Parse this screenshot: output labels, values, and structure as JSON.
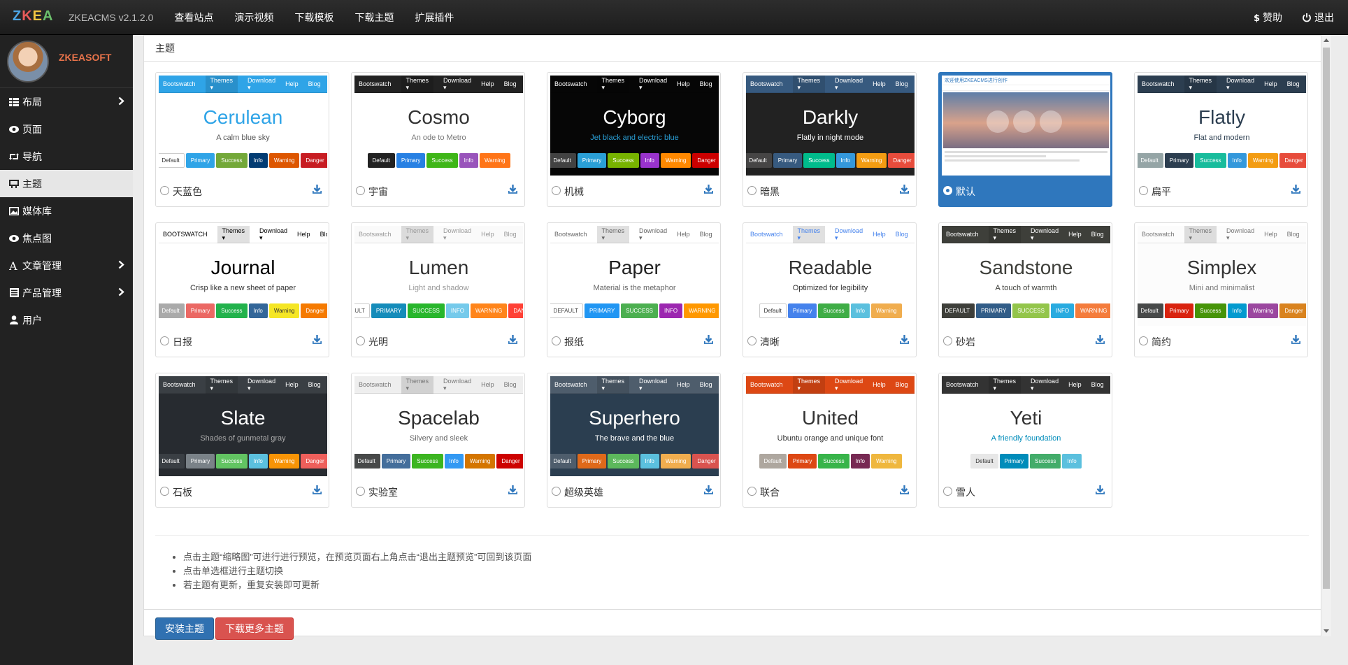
{
  "app": {
    "logo_letters": [
      "Z",
      "K",
      "E",
      "A"
    ],
    "logo_colors": [
      "#4da7e8",
      "#e85b5b",
      "#f4c542",
      "#6cc06c"
    ],
    "version": "ZKEACMS v2.1.2.0"
  },
  "topnav": [
    {
      "label": "查看站点"
    },
    {
      "label": "演示视频"
    },
    {
      "label": "下载模板"
    },
    {
      "label": "下载主题"
    },
    {
      "label": "扩展插件"
    }
  ],
  "topright": {
    "donate": "赞助",
    "logout": "退出"
  },
  "profile": {
    "name": "ZKEASOFT"
  },
  "sidebar": [
    {
      "label": "布局",
      "icon": "layout-icon",
      "has_sub": true,
      "active": false
    },
    {
      "label": "页面",
      "icon": "eye-icon",
      "has_sub": false,
      "active": false
    },
    {
      "label": "导航",
      "icon": "retweet-icon",
      "has_sub": false,
      "active": false
    },
    {
      "label": "主题",
      "icon": "blackboard-icon",
      "has_sub": false,
      "active": true
    },
    {
      "label": "媒体库",
      "icon": "picture-icon",
      "has_sub": false,
      "active": false
    },
    {
      "label": "焦点图",
      "icon": "eye-icon",
      "has_sub": false,
      "active": false
    },
    {
      "label": "文章管理",
      "icon": "font-icon",
      "has_sub": true,
      "active": false
    },
    {
      "label": "产品管理",
      "icon": "list-alt-icon",
      "has_sub": true,
      "active": false
    },
    {
      "label": "用户",
      "icon": "user-icon",
      "has_sub": false,
      "active": false
    }
  ],
  "panel": {
    "title": "主题"
  },
  "themes": [
    {
      "id": "cerulean",
      "name": "天蓝色",
      "title": "Cerulean",
      "subtitle": "A calm blue sky",
      "nav_bg": "#2fa4e7",
      "nav_fg": "#ffffff",
      "body_bg": "#ffffff",
      "title_color": "#2fa4e7",
      "sub_color": "#555555",
      "brand": "Bootswatch",
      "selected": false,
      "buttons": [
        {
          "t": "Default",
          "bg": "#ffffff",
          "fg": "#333"
        },
        {
          "t": "Primary",
          "bg": "#2fa4e7",
          "fg": "#fff"
        },
        {
          "t": "Success",
          "bg": "#73a839",
          "fg": "#fff"
        },
        {
          "t": "Info",
          "bg": "#033c73",
          "fg": "#fff"
        },
        {
          "t": "Warning",
          "bg": "#dd5600",
          "fg": "#fff"
        },
        {
          "t": "Danger",
          "bg": "#c71c22",
          "fg": "#fff"
        }
      ]
    },
    {
      "id": "cosmo",
      "name": "宇宙",
      "title": "Cosmo",
      "subtitle": "An ode to Metro",
      "nav_bg": "#222222",
      "nav_fg": "#ffffff",
      "body_bg": "#ffffff",
      "title_color": "#333333",
      "sub_color": "#777777",
      "brand": "Bootswatch",
      "selected": false,
      "buttons": [
        {
          "t": "Default",
          "bg": "#222222",
          "fg": "#fff"
        },
        {
          "t": "Primary",
          "bg": "#2780e3",
          "fg": "#fff"
        },
        {
          "t": "Success",
          "bg": "#3fb618",
          "fg": "#fff"
        },
        {
          "t": "Info",
          "bg": "#9954bb",
          "fg": "#fff"
        },
        {
          "t": "Warning",
          "bg": "#ff7518",
          "fg": "#fff"
        }
      ]
    },
    {
      "id": "cyborg",
      "name": "机械",
      "title": "Cyborg",
      "subtitle": "Jet black and electric blue",
      "nav_bg": "#060606",
      "nav_fg": "#ffffff",
      "body_bg": "#060606",
      "title_color": "#ffffff",
      "sub_color": "#2a9fd6",
      "brand": "Bootswatch",
      "selected": false,
      "buttons": [
        {
          "t": "Default",
          "bg": "#424242",
          "fg": "#fff"
        },
        {
          "t": "Primary",
          "bg": "#2a9fd6",
          "fg": "#fff"
        },
        {
          "t": "Success",
          "bg": "#77b300",
          "fg": "#fff"
        },
        {
          "t": "Info",
          "bg": "#9933cc",
          "fg": "#fff"
        },
        {
          "t": "Warning",
          "bg": "#ff8800",
          "fg": "#fff"
        },
        {
          "t": "Danger",
          "bg": "#cc0000",
          "fg": "#fff"
        }
      ]
    },
    {
      "id": "darkly",
      "name": "暗黑",
      "title": "Darkly",
      "subtitle": "Flatly in night mode",
      "nav_bg": "#375a7f",
      "nav_fg": "#ffffff",
      "body_bg": "#222222",
      "title_color": "#ffffff",
      "sub_color": "#ffffff",
      "brand": "Bootswatch",
      "selected": false,
      "buttons": [
        {
          "t": "Default",
          "bg": "#464545",
          "fg": "#fff"
        },
        {
          "t": "Primary",
          "bg": "#375a7f",
          "fg": "#fff"
        },
        {
          "t": "Success",
          "bg": "#00bc8c",
          "fg": "#fff"
        },
        {
          "t": "Info",
          "bg": "#3498db",
          "fg": "#fff"
        },
        {
          "t": "Warning",
          "bg": "#f39c12",
          "fg": "#fff"
        },
        {
          "t": "Danger",
          "bg": "#e74c3c",
          "fg": "#fff"
        }
      ]
    },
    {
      "id": "default",
      "name": "默认",
      "title": "",
      "subtitle": "",
      "nav_bg": "#ffffff",
      "nav_fg": "#2f77bd",
      "body_bg": "#ffffff",
      "title_color": "#333",
      "sub_color": "#333",
      "brand": "欢迎使用ZKEACMS进行创作",
      "selected": true,
      "buttons": []
    },
    {
      "id": "flatly",
      "name": "扁平",
      "title": "Flatly",
      "subtitle": "Flat and modern",
      "nav_bg": "#2c3e50",
      "nav_fg": "#ffffff",
      "body_bg": "#ffffff",
      "title_color": "#2c3e50",
      "sub_color": "#2c3e50",
      "brand": "Bootswatch",
      "selected": false,
      "buttons": [
        {
          "t": "Default",
          "bg": "#95a5a6",
          "fg": "#fff"
        },
        {
          "t": "Primary",
          "bg": "#2c3e50",
          "fg": "#fff"
        },
        {
          "t": "Success",
          "bg": "#18bc9c",
          "fg": "#fff"
        },
        {
          "t": "Info",
          "bg": "#3498db",
          "fg": "#fff"
        },
        {
          "t": "Warning",
          "bg": "#f39c12",
          "fg": "#fff"
        },
        {
          "t": "Danger",
          "bg": "#e74c3c",
          "fg": "#fff"
        }
      ]
    },
    {
      "id": "journal",
      "name": "日报",
      "title": "Journal",
      "subtitle": "Crisp like a new sheet of paper",
      "nav_bg": "#ffffff",
      "nav_fg": "#000000",
      "body_bg": "#ffffff",
      "title_color": "#000000",
      "sub_color": "#333333",
      "brand": "BOOTSWATCH",
      "selected": false,
      "buttons": [
        {
          "t": "Default",
          "bg": "#aaaaaa",
          "fg": "#fff"
        },
        {
          "t": "Primary",
          "bg": "#eb6864",
          "fg": "#fff"
        },
        {
          "t": "Success",
          "bg": "#22b24c",
          "fg": "#fff"
        },
        {
          "t": "Info",
          "bg": "#336699",
          "fg": "#fff"
        },
        {
          "t": "Warning",
          "bg": "#f5e625",
          "fg": "#333"
        },
        {
          "t": "Danger",
          "bg": "#f57a00",
          "fg": "#fff"
        }
      ]
    },
    {
      "id": "lumen",
      "name": "光明",
      "title": "Lumen",
      "subtitle": "Light and shadow",
      "nav_bg": "#fafafa",
      "nav_fg": "#999999",
      "body_bg": "#ffffff",
      "title_color": "#333333",
      "sub_color": "#999999",
      "brand": "Bootswatch",
      "selected": false,
      "buttons": [
        {
          "t": "DEFAULT",
          "bg": "#ffffff",
          "fg": "#555"
        },
        {
          "t": "PRIMARY",
          "bg": "#158cba",
          "fg": "#fff"
        },
        {
          "t": "SUCCESS",
          "bg": "#28b62c",
          "fg": "#fff"
        },
        {
          "t": "INFO",
          "bg": "#75caeb",
          "fg": "#fff"
        },
        {
          "t": "WARNING",
          "bg": "#ff851b",
          "fg": "#fff"
        },
        {
          "t": "DANGER",
          "bg": "#ff4136",
          "fg": "#fff"
        }
      ]
    },
    {
      "id": "paper",
      "name": "报纸",
      "title": "Paper",
      "subtitle": "Material is the metaphor",
      "nav_bg": "#ffffff",
      "nav_fg": "#666666",
      "body_bg": "#ffffff",
      "title_color": "#212121",
      "sub_color": "#666666",
      "brand": "Bootswatch",
      "selected": false,
      "buttons": [
        {
          "t": "DEFAULT",
          "bg": "#ffffff",
          "fg": "#444"
        },
        {
          "t": "PRIMARY",
          "bg": "#2196f3",
          "fg": "#fff"
        },
        {
          "t": "SUCCESS",
          "bg": "#4caf50",
          "fg": "#fff"
        },
        {
          "t": "INFO",
          "bg": "#9c27b0",
          "fg": "#fff"
        },
        {
          "t": "WARNING",
          "bg": "#ff9800",
          "fg": "#fff"
        }
      ]
    },
    {
      "id": "readable",
      "name": "清晰",
      "title": "Readable",
      "subtitle": "Optimized for legibility",
      "nav_bg": "#ffffff",
      "nav_fg": "#4582ec",
      "body_bg": "#ffffff",
      "title_color": "#333333",
      "sub_color": "#333333",
      "brand": "Bootswatch",
      "selected": false,
      "buttons": [
        {
          "t": "Default",
          "bg": "#ffffff",
          "fg": "#333"
        },
        {
          "t": "Primary",
          "bg": "#4582ec",
          "fg": "#fff"
        },
        {
          "t": "Success",
          "bg": "#3fad46",
          "fg": "#fff"
        },
        {
          "t": "Info",
          "bg": "#5bc0de",
          "fg": "#fff"
        },
        {
          "t": "Warning",
          "bg": "#f0ad4e",
          "fg": "#fff"
        }
      ]
    },
    {
      "id": "sandstone",
      "name": "砂岩",
      "title": "Sandstone",
      "subtitle": "A touch of warmth",
      "nav_bg": "#3e3f3a",
      "nav_fg": "#ffffff",
      "body_bg": "#ffffff",
      "title_color": "#3e3f3a",
      "sub_color": "#3e3f3a",
      "brand": "Bootswatch",
      "selected": false,
      "buttons": [
        {
          "t": "DEFAULT",
          "bg": "#3e3f3a",
          "fg": "#fff"
        },
        {
          "t": "PRIMARY",
          "bg": "#325d88",
          "fg": "#fff"
        },
        {
          "t": "SUCCESS",
          "bg": "#93c54b",
          "fg": "#fff"
        },
        {
          "t": "INFO",
          "bg": "#29abe0",
          "fg": "#fff"
        },
        {
          "t": "WARNING",
          "bg": "#f47c3c",
          "fg": "#fff"
        }
      ]
    },
    {
      "id": "simplex",
      "name": "简约",
      "title": "Simplex",
      "subtitle": "Mini and minimalist",
      "nav_bg": "#fcfcfc",
      "nav_fg": "#777777",
      "body_bg": "#fcfcfc",
      "title_color": "#333333",
      "sub_color": "#777777",
      "brand": "Bootswatch",
      "selected": false,
      "buttons": [
        {
          "t": "Default",
          "bg": "#474949",
          "fg": "#fff"
        },
        {
          "t": "Primary",
          "bg": "#d9230f",
          "fg": "#fff"
        },
        {
          "t": "Success",
          "bg": "#469408",
          "fg": "#fff"
        },
        {
          "t": "Info",
          "bg": "#029acf",
          "fg": "#fff"
        },
        {
          "t": "Warning",
          "bg": "#9b479f",
          "fg": "#fff"
        },
        {
          "t": "Danger",
          "bg": "#d9831f",
          "fg": "#fff"
        }
      ]
    },
    {
      "id": "slate",
      "name": "石板",
      "title": "Slate",
      "subtitle": "Shades of gunmetal gray",
      "nav_bg": "#3a3f44",
      "nav_fg": "#ffffff",
      "body_bg": "#272b30",
      "title_color": "#ffffff",
      "sub_color": "#aaaaaa",
      "brand": "Bootswatch",
      "selected": false,
      "buttons": [
        {
          "t": "Default",
          "bg": "#3a3f44",
          "fg": "#fff"
        },
        {
          "t": "Primary",
          "bg": "#7a8288",
          "fg": "#fff"
        },
        {
          "t": "Success",
          "bg": "#62c462",
          "fg": "#fff"
        },
        {
          "t": "Info",
          "bg": "#5bc0de",
          "fg": "#fff"
        },
        {
          "t": "Warning",
          "bg": "#f89406",
          "fg": "#fff"
        },
        {
          "t": "Danger",
          "bg": "#ee5f5b",
          "fg": "#fff"
        }
      ]
    },
    {
      "id": "spacelab",
      "name": "实验室",
      "title": "Spacelab",
      "subtitle": "Silvery and sleek",
      "nav_bg": "#eeeeee",
      "nav_fg": "#777777",
      "body_bg": "#ffffff",
      "title_color": "#2d2d2d",
      "sub_color": "#666666",
      "brand": "Bootswatch",
      "selected": false,
      "buttons": [
        {
          "t": "Default",
          "bg": "#474949",
          "fg": "#fff"
        },
        {
          "t": "Primary",
          "bg": "#446e9b",
          "fg": "#fff"
        },
        {
          "t": "Success",
          "bg": "#3cb521",
          "fg": "#fff"
        },
        {
          "t": "Info",
          "bg": "#3399f3",
          "fg": "#fff"
        },
        {
          "t": "Warning",
          "bg": "#d47500",
          "fg": "#fff"
        },
        {
          "t": "Danger",
          "bg": "#cd0200",
          "fg": "#fff"
        }
      ]
    },
    {
      "id": "superhero",
      "name": "超级英雄",
      "title": "Superhero",
      "subtitle": "The brave and the blue",
      "nav_bg": "#4e5d6c",
      "nav_fg": "#ffffff",
      "body_bg": "#2b3e50",
      "title_color": "#ffffff",
      "sub_color": "#ffffff",
      "brand": "Bootswatch",
      "selected": false,
      "buttons": [
        {
          "t": "Default",
          "bg": "#4e5d6c",
          "fg": "#fff"
        },
        {
          "t": "Primary",
          "bg": "#df691a",
          "fg": "#fff"
        },
        {
          "t": "Success",
          "bg": "#5cb85c",
          "fg": "#fff"
        },
        {
          "t": "Info",
          "bg": "#5bc0de",
          "fg": "#fff"
        },
        {
          "t": "Warning",
          "bg": "#f0ad4e",
          "fg": "#fff"
        },
        {
          "t": "Danger",
          "bg": "#d9534f",
          "fg": "#fff"
        }
      ]
    },
    {
      "id": "united",
      "name": "联合",
      "title": "United",
      "subtitle": "Ubuntu orange and unique font",
      "nav_bg": "#dd4814",
      "nav_fg": "#ffffff",
      "body_bg": "#ffffff",
      "title_color": "#333333",
      "sub_color": "#333333",
      "brand": "Bootswatch",
      "selected": false,
      "buttons": [
        {
          "t": "Default",
          "bg": "#aea79f",
          "fg": "#fff"
        },
        {
          "t": "Primary",
          "bg": "#dd4814",
          "fg": "#fff"
        },
        {
          "t": "Success",
          "bg": "#38b44a",
          "fg": "#fff"
        },
        {
          "t": "Info",
          "bg": "#772953",
          "fg": "#fff"
        },
        {
          "t": "Warning",
          "bg": "#efb73e",
          "fg": "#fff"
        }
      ]
    },
    {
      "id": "yeti",
      "name": "雪人",
      "title": "Yeti",
      "subtitle": "A friendly foundation",
      "nav_bg": "#333333",
      "nav_fg": "#ffffff",
      "body_bg": "#ffffff",
      "title_color": "#333333",
      "sub_color": "#008cba",
      "brand": "Bootswatch",
      "selected": false,
      "buttons": [
        {
          "t": "Default",
          "bg": "#e7e7e7",
          "fg": "#333"
        },
        {
          "t": "Primary",
          "bg": "#008cba",
          "fg": "#fff"
        },
        {
          "t": "Success",
          "bg": "#43ac6a",
          "fg": "#fff"
        },
        {
          "t": "Info",
          "bg": "#5bc0de",
          "fg": "#fff"
        }
      ]
    }
  ],
  "notes": [
    "点击主题“缩略图”可进行进行预览，在预览页面右上角点击“退出主题预览”可回到该页面",
    "点击单选框进行主题切换",
    "若主题有更新，重复安装即可更新"
  ],
  "actions": {
    "install": "安装主题",
    "download_more": "下载更多主题"
  }
}
